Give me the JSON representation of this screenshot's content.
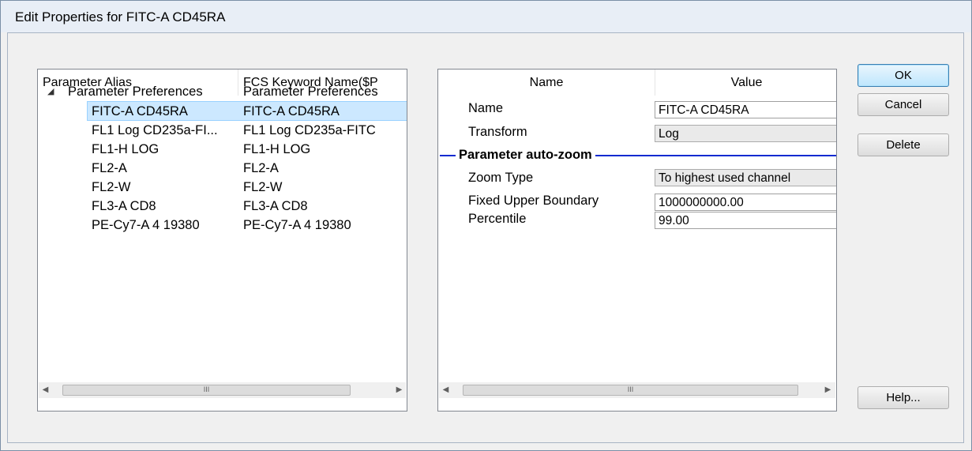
{
  "window": {
    "title": "Edit Properties for FITC-A CD45RA"
  },
  "left_panel": {
    "columns": [
      "Parameter Alias",
      "FCS Keyword Name($P"
    ],
    "group": {
      "alias": "Parameter Preferences",
      "keyword": "Parameter Preferences",
      "expanded": true
    },
    "rows": [
      {
        "alias": "FITC-A CD45RA",
        "keyword": "FITC-A CD45RA",
        "selected": true
      },
      {
        "alias": "FL1 Log CD235a-FI...",
        "keyword": "FL1 Log CD235a-FITC",
        "selected": false
      },
      {
        "alias": "FL1-H LOG",
        "keyword": "FL1-H LOG",
        "selected": false
      },
      {
        "alias": "FL2-A",
        "keyword": "FL2-A",
        "selected": false
      },
      {
        "alias": "FL2-W",
        "keyword": "FL2-W",
        "selected": false
      },
      {
        "alias": "FL3-A CD8",
        "keyword": "FL3-A CD8",
        "selected": false
      },
      {
        "alias": "PE-Cy7-A 4 19380",
        "keyword": "PE-Cy7-A 4 19380",
        "selected": false
      }
    ],
    "scroll_thumb_glyph": "III"
  },
  "right_panel": {
    "columns": [
      "Name",
      "Value"
    ],
    "properties": [
      {
        "label": "Name",
        "value": "FITC-A CD45RA",
        "kind": "text"
      },
      {
        "label": "Transform",
        "value": "Log",
        "kind": "combo"
      }
    ],
    "section": "Parameter auto-zoom",
    "section_properties": [
      {
        "label": "Zoom Type",
        "value": "To highest used channel",
        "kind": "combo"
      },
      {
        "label": "Fixed Upper Boundary",
        "value": "1000000000.00",
        "kind": "text"
      },
      {
        "label": "Percentile",
        "value": "99.00",
        "kind": "text"
      }
    ],
    "scroll_thumb_glyph": "III"
  },
  "buttons": {
    "ok": "OK",
    "cancel": "Cancel",
    "delete": "Delete",
    "help": "Help..."
  },
  "colors": {
    "selection": "#cce8ff",
    "section_line": "#0a2ad0",
    "default_button_border": "#3c7fb1"
  }
}
